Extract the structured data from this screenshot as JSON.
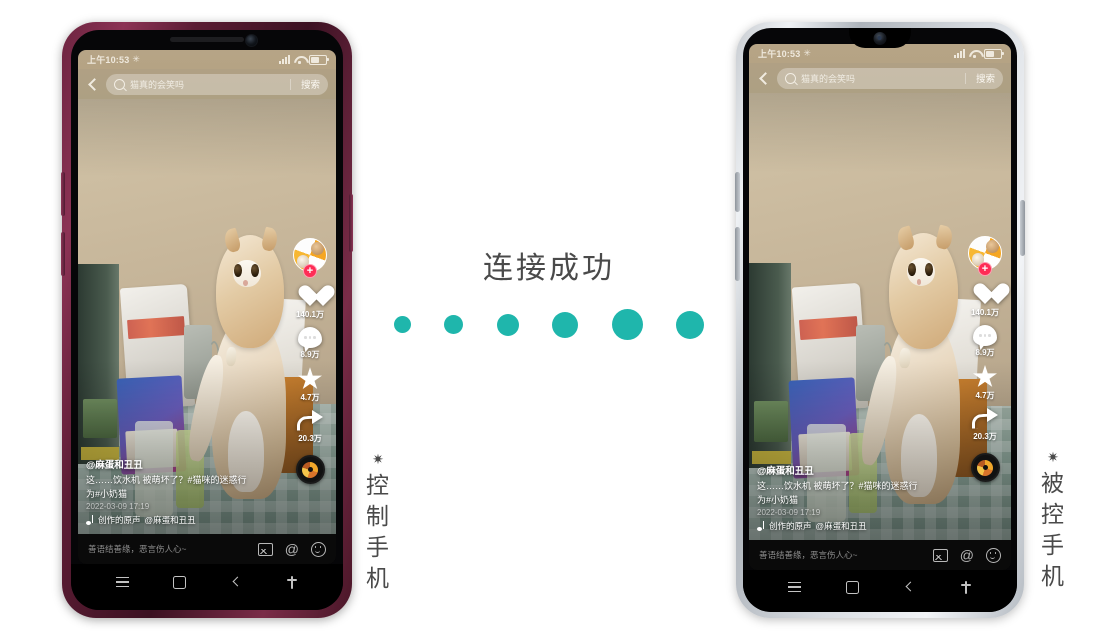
{
  "left_phone": {
    "role_label": "控制手机",
    "role_marker": "✷",
    "frame_color": "#6d2440",
    "status": {
      "time": "上午10:53",
      "bluetooth_icon": "bluetooth-icon",
      "signal_icon": "signal-icon",
      "wifi_icon": "wifi-icon",
      "battery_icon": "battery-icon"
    },
    "search": {
      "back_icon": "back-chevron-icon",
      "magnifier_icon": "search-icon",
      "query": "猫真的会笑吗",
      "button": "搜索"
    },
    "rail": {
      "avatar_name": "avatar",
      "follow_plus": "+",
      "like_icon": "heart-icon",
      "like_count": "140.1万",
      "comment_icon": "comment-icon",
      "comment_count": "8.9万",
      "favorite_icon": "star-icon",
      "favorite_count": "4.7万",
      "share_icon": "share-icon",
      "share_count": "20.3万",
      "music_disc": "music-disc-icon"
    },
    "caption": {
      "username": "@麻蛋和丑丑",
      "text_line1": "这……饮水机 被萌坏了？#猫咪的迷惑行",
      "text_line2": "为#小奶猫",
      "date": "2022-03-09 17:19",
      "music_icon": "music-note-icon",
      "music_text": "创作的原声",
      "music_author": "@麻蛋和丑丑"
    },
    "composer": {
      "placeholder": "善语结善缘，恶言伤人心~",
      "image_icon": "image-icon",
      "at_icon": "at-icon",
      "emoji_icon": "smiley-icon"
    },
    "navbar": {
      "menu_icon": "menu-icon",
      "home_icon": "home-square-icon",
      "back_icon": "back-chevron-icon",
      "accessibility_icon": "accessibility-icon"
    }
  },
  "right_phone": {
    "role_label": "被控手机",
    "role_marker": "✷",
    "frame_color": "#c9cdd2",
    "status": {
      "time": "上午10:53",
      "bluetooth_icon": "bluetooth-icon",
      "signal_icon": "signal-icon",
      "wifi_icon": "wifi-icon",
      "battery_icon": "battery-icon"
    },
    "search": {
      "back_icon": "back-chevron-icon",
      "magnifier_icon": "search-icon",
      "query": "猫真的会笑吗",
      "button": "搜索"
    },
    "rail": {
      "avatar_name": "avatar",
      "follow_plus": "+",
      "like_icon": "heart-icon",
      "like_count": "140.1万",
      "comment_icon": "comment-icon",
      "comment_count": "8.9万",
      "favorite_icon": "star-icon",
      "favorite_count": "4.7万",
      "share_icon": "share-icon",
      "share_count": "20.3万",
      "music_disc": "music-disc-icon"
    },
    "caption": {
      "username": "@麻蛋和丑丑",
      "text_line1": "这……饮水机 被萌坏了？#猫咪的迷惑行",
      "text_line2": "为#小奶猫",
      "date": "2022-03-09 17:19",
      "music_icon": "music-note-icon",
      "music_text": "创作的原声",
      "music_author": "@麻蛋和丑丑"
    },
    "composer": {
      "placeholder": "善语结善缘，恶言伤人心~",
      "image_icon": "image-icon",
      "at_icon": "at-icon",
      "emoji_icon": "smiley-icon"
    },
    "navbar": {
      "menu_icon": "menu-icon",
      "home_icon": "home-square-icon",
      "back_icon": "back-chevron-icon",
      "accessibility_icon": "accessibility-icon"
    }
  },
  "center": {
    "title": "连接成功",
    "dot_color": "#1fb6ac",
    "dot_sizes": [
      17,
      19,
      22,
      26,
      31,
      28
    ]
  }
}
